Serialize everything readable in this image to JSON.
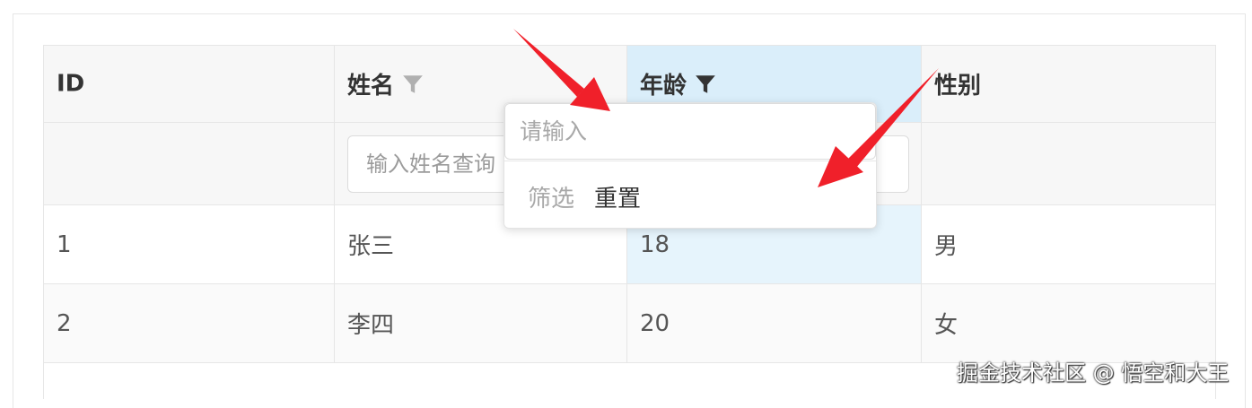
{
  "table": {
    "headers": {
      "id": "ID",
      "name": "姓名",
      "age": "年龄",
      "gender": "性别"
    },
    "name_filter_placeholder": "输入姓名查询",
    "rows": [
      {
        "id": "1",
        "name": "张三",
        "age": "18",
        "gender": "男"
      },
      {
        "id": "2",
        "name": "李四",
        "age": "20",
        "gender": "女"
      }
    ]
  },
  "popover": {
    "input_placeholder": "请输入",
    "filter_label": "筛选",
    "reset_label": "重置"
  },
  "icons": {
    "name_filter": "filter-icon",
    "age_filter": "filter-icon-active"
  },
  "colors": {
    "active_column_header": "#daeefa",
    "active_column_cell": "#e6f4fc",
    "annotation_arrow": "#f0202a",
    "filter_icon_inactive": "#b0b0b0",
    "filter_icon_active": "#333333"
  },
  "watermark": "掘金技术社区 @ 悟空和大王"
}
